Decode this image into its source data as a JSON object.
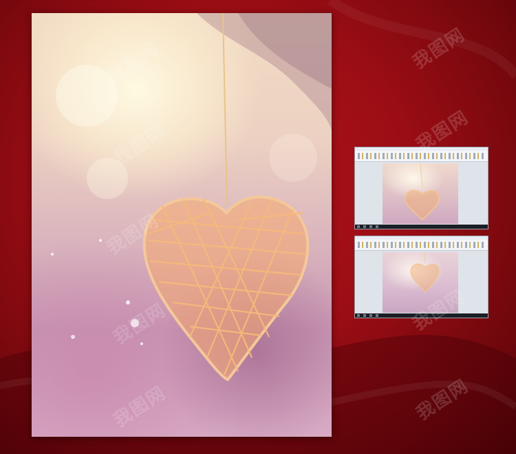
{
  "watermark": {
    "text": "我图网"
  },
  "preview_thumbnails": [
    {
      "caption": ""
    },
    {
      "caption": ""
    }
  ]
}
